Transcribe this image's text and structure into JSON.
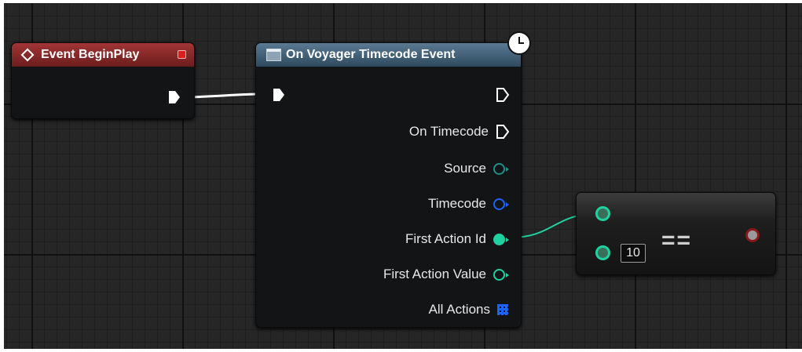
{
  "nodes": {
    "begin_play": {
      "title": "Event BeginPlay"
    },
    "timecode_event": {
      "title": "On Voyager Timecode Event",
      "pins": [
        {
          "label": "On Timecode",
          "type": "exec"
        },
        {
          "label": "Source",
          "type": "object",
          "color": "#1f8f8a"
        },
        {
          "label": "Timecode",
          "type": "struct",
          "color": "#1c63ff"
        },
        {
          "label": "First Action Id",
          "type": "int",
          "color": "#1fd1a0",
          "connected": true
        },
        {
          "label": "First Action Value",
          "type": "int",
          "color": "#1fd1a0"
        },
        {
          "label": "All Actions",
          "type": "map",
          "color": "#1c63ff"
        }
      ]
    },
    "equal": {
      "operator": "==",
      "default_value": "10"
    }
  },
  "colors": {
    "begin_header": "#8e2b2b",
    "event_header": "#4a6a83",
    "int_pin": "#1fd1a0",
    "struct_pin": "#1c63ff",
    "object_pin": "#1f8f8a",
    "bool_pin": "#8a1818"
  }
}
